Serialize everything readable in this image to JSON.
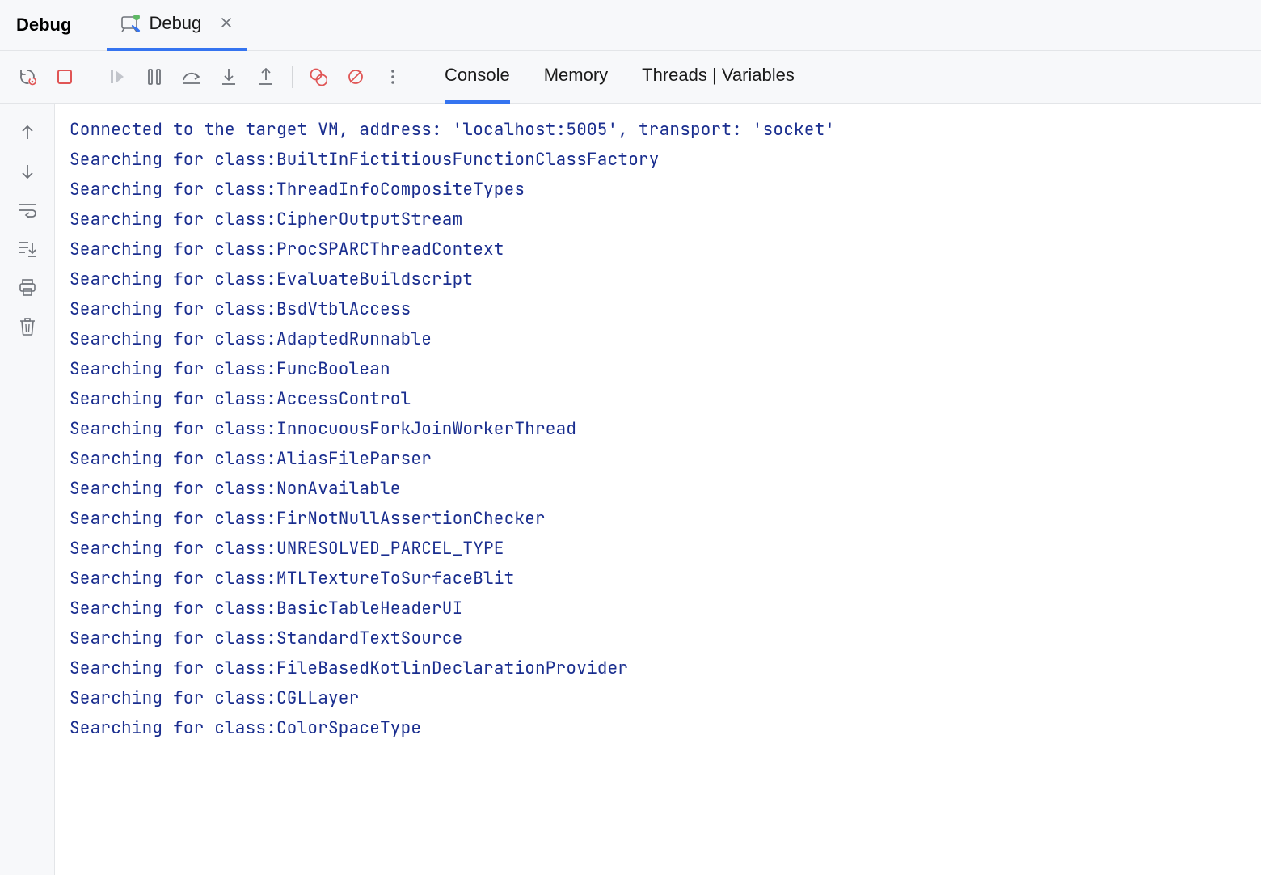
{
  "header": {
    "title": "Debug",
    "tab": {
      "label": "Debug"
    }
  },
  "toolbar": {
    "rerun": "rerun",
    "stop": "stop",
    "resume": "resume",
    "pause": "pause",
    "step_over": "step-over",
    "step_into": "step-into",
    "step_out": "step-out",
    "view_breakpoints": "view-breakpoints",
    "mute_breakpoints": "mute-breakpoints",
    "more": "more"
  },
  "view_tabs": {
    "console": "Console",
    "memory": "Memory",
    "threads_vars": "Threads | Variables"
  },
  "side": {
    "up": "up",
    "down": "down",
    "soft_wrap": "soft-wrap",
    "scroll_end": "scroll-to-end",
    "print": "print",
    "clear": "clear-all"
  },
  "console_lines": [
    "Connected to the target VM, address: 'localhost:5005', transport: 'socket'",
    "Searching for class:BuiltInFictitiousFunctionClassFactory",
    "Searching for class:ThreadInfoCompositeTypes",
    "Searching for class:CipherOutputStream",
    "Searching for class:ProcSPARCThreadContext",
    "Searching for class:EvaluateBuildscript",
    "Searching for class:BsdVtblAccess",
    "Searching for class:AdaptedRunnable",
    "Searching for class:FuncBoolean",
    "Searching for class:AccessControl",
    "Searching for class:InnocuousForkJoinWorkerThread",
    "Searching for class:AliasFileParser",
    "Searching for class:NonAvailable",
    "Searching for class:FirNotNullAssertionChecker",
    "Searching for class:UNRESOLVED_PARCEL_TYPE",
    "Searching for class:MTLTextureToSurfaceBlit",
    "Searching for class:BasicTableHeaderUI",
    "Searching for class:StandardTextSource",
    "Searching for class:FileBasedKotlinDeclarationProvider",
    "Searching for class:CGLLayer",
    "Searching for class:ColorSpaceType"
  ]
}
